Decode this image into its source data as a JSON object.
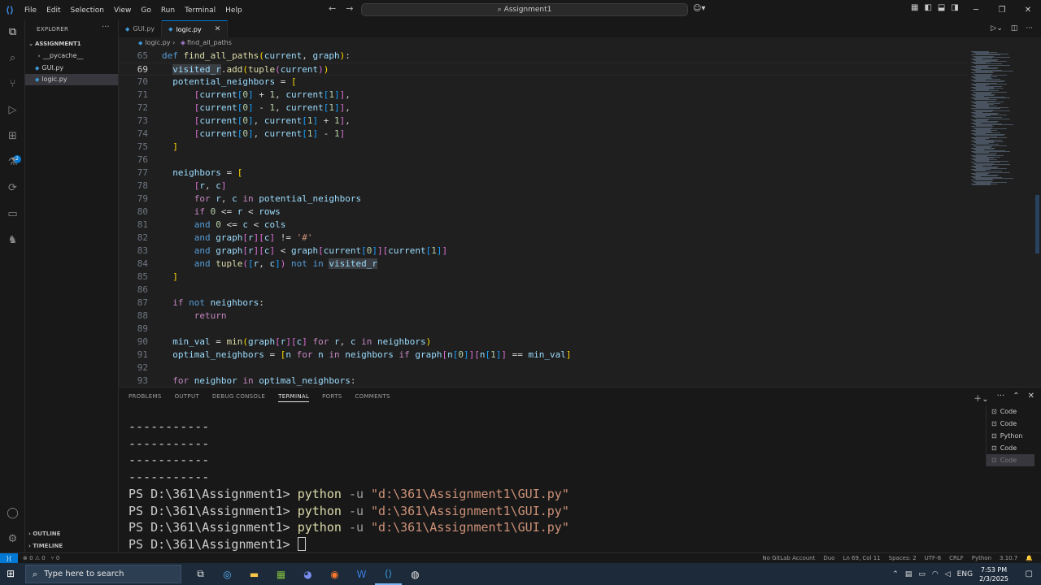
{
  "titlebar": {
    "menu": [
      "File",
      "Edit",
      "Selection",
      "View",
      "Go",
      "Run",
      "Terminal",
      "Help"
    ],
    "search_text": "Assignment1"
  },
  "sidebar": {
    "title": "EXPLORER",
    "root": "ASSIGNMENT1",
    "items": [
      {
        "label": "__pycache__",
        "kind": "folder"
      },
      {
        "label": "GUI.py",
        "kind": "python"
      },
      {
        "label": "logic.py",
        "kind": "python",
        "selected": true
      }
    ],
    "outline": "OUTLINE",
    "timeline": "TIMELINE",
    "scm_badge": "2"
  },
  "tabs": [
    {
      "label": "GUI.py",
      "active": false
    },
    {
      "label": "logic.py",
      "active": true
    }
  ],
  "breadcrumb": {
    "file": "logic.py",
    "symbol": "find_all_paths"
  },
  "editor": {
    "current_line": "69",
    "line_numbers": [
      "65",
      "69",
      "70",
      "71",
      "72",
      "73",
      "74",
      "75",
      "76",
      "77",
      "78",
      "79",
      "80",
      "81",
      "82",
      "83",
      "84",
      "85",
      "86",
      "87",
      "88",
      "89",
      "90",
      "91",
      "92",
      "93"
    ]
  },
  "panel": {
    "tabs": [
      "PROBLEMS",
      "OUTPUT",
      "DEBUG CONSOLE",
      "TERMINAL",
      "PORTS",
      "COMMENTS"
    ],
    "active_tab": "TERMINAL",
    "terminal": {
      "separator": "-----------",
      "prompt": "PS D:\\361\\Assignment1> ",
      "cmd": "python",
      "flag": "-u",
      "arg": "\"d:\\361\\Assignment1\\GUI.py\""
    },
    "terminal_list": [
      "Code",
      "Code",
      "Python",
      "Code",
      "Code"
    ]
  },
  "status": {
    "problems": "⊗ 0 ⚠ 0",
    "ports": "⑂ 0",
    "gitlab": "No GitLab Account",
    "duo": "Duo",
    "position": "Ln 69, Col 11",
    "spaces": "Spaces: 2",
    "encoding": "UTF-8",
    "eol": "CRLF",
    "language": "Python",
    "version": "3.10.7"
  },
  "taskbar": {
    "search_placeholder": "Type here to search",
    "lang": "ENG",
    "time": "7:53 PM",
    "date": "2/3/2025"
  },
  "colors": {
    "accent": "#0078d4",
    "editor_bg": "#1f1f1f",
    "taskbar_bg": "#1c2a3a"
  }
}
